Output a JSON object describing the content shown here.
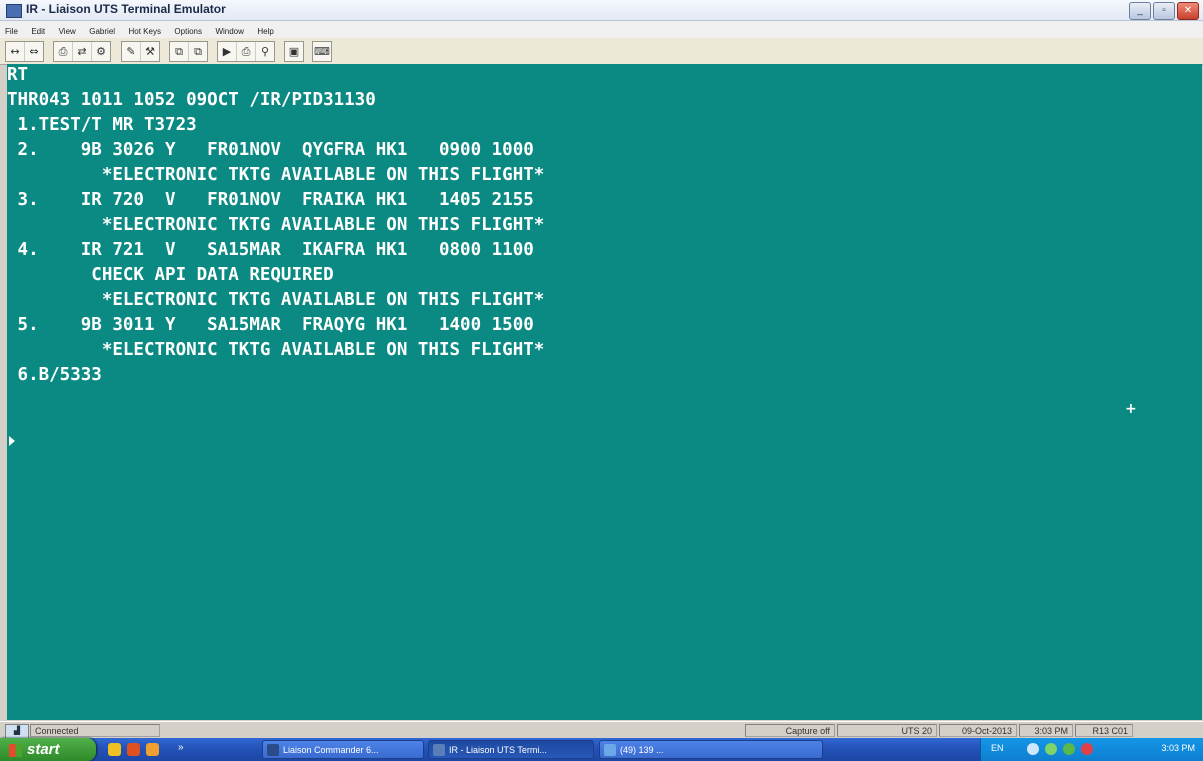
{
  "window": {
    "title": "IR - Liaison UTS Terminal Emulator",
    "buttons": {
      "minimize": "_",
      "restore": "▫",
      "close": "✕"
    }
  },
  "menu": [
    "File",
    "Edit",
    "View",
    "Gabriel",
    "Hot Keys",
    "Options",
    "Window",
    "Help"
  ],
  "toolbar_groups": [
    [
      "↔",
      "⇔"
    ],
    [
      "⎙",
      "⇄",
      "⚙"
    ],
    [
      "✎",
      "⚒"
    ],
    [
      "⧉",
      "⧉"
    ],
    [
      "▶",
      "⎙",
      "⚲"
    ],
    [
      "▣"
    ],
    [
      "⌨"
    ]
  ],
  "terminal": {
    "lines": [
      "RT",
      "THR043 1011 1052 09OCT /IR/PID31130",
      " 1.TEST/T MR T3723",
      " 2.    9B 3026 Y   FR01NOV  QYGFRA HK1   0900 1000",
      "         *ELECTRONIC TKTG AVAILABLE ON THIS FLIGHT*",
      " 3.    IR 720  V   FR01NOV  FRAIKA HK1   1405 2155",
      "         *ELECTRONIC TKTG AVAILABLE ON THIS FLIGHT*",
      " 4.    IR 721  V   SA15MAR  IKAFRA HK1   0800 1100",
      "        CHECK API DATA REQUIRED",
      "         *ELECTRONIC TKTG AVAILABLE ON THIS FLIGHT*",
      " 5.    9B 3011 Y   SA15MAR  FRAQYG HK1   1400 1500",
      "         *ELECTRONIC TKTG AVAILABLE ON THIS FLIGHT*",
      " 6.B/5333"
    ],
    "cursor_marker": "+"
  },
  "statusbar": {
    "connection": "Connected",
    "capture": "Capture off",
    "mode": "UTS 20",
    "date": "09-Oct-2013",
    "time": "3:03 PM",
    "position": "R13 C01"
  },
  "taskbar": {
    "start_label": "start",
    "tasks": [
      {
        "label": "Liaison Commander 6...",
        "active": false
      },
      {
        "label": "IR - Liaison UTS Termi...",
        "active": true
      },
      {
        "label": "(49) 139 ...",
        "active": false
      }
    ],
    "language": "EN",
    "clock": "3:03 PM"
  },
  "colors": {
    "terminal_bg": "#0b8a83",
    "terminal_text": "#ffffff"
  }
}
